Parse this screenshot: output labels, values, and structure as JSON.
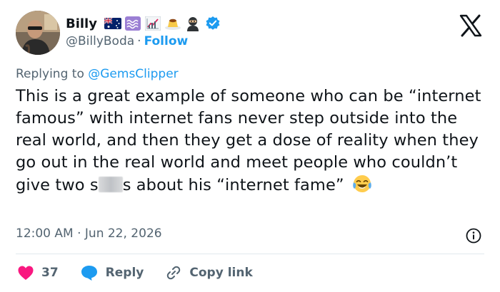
{
  "author": {
    "display_name": "Billy",
    "handle": "@BillyBoda",
    "separator": "·",
    "follow_label": "Follow",
    "badges": [
      "australia-flag-icon",
      "waves-icon",
      "chart-increasing-icon",
      "pudding-icon",
      "ninja-icon",
      "verified-badge-icon"
    ]
  },
  "reply_to": {
    "prefix": "Replying to",
    "mention": "@GemsClipper"
  },
  "tweet": {
    "text_before_censor": "This is a great example of someone who can be “internet famous” with internet fans never step outside into the real world, and then they get a dose of reality when they go out in the real world and meet people who couldn’t give two s",
    "text_after_censor": "s about his “internet fame”",
    "emoji": "face-with-tears-of-joy-icon"
  },
  "meta": {
    "timestamp": "12:00 AM · Jun 22, 2026"
  },
  "actions": {
    "like_count": "37",
    "reply_label": "Reply",
    "copy_link_label": "Copy link"
  },
  "colors": {
    "text_primary": "#0f1419",
    "text_secondary": "#536471",
    "link": "#1d9bf0",
    "like": "#f91880",
    "divider": "#e1e8ed"
  }
}
